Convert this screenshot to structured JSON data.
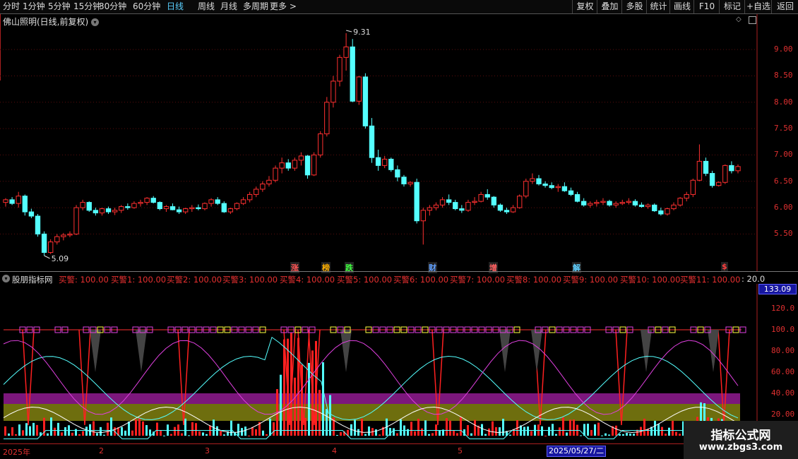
{
  "toolbar": {
    "periods": [
      "分时",
      "1分钟",
      "5分钟",
      "15分钟",
      "30分钟",
      "60分钟",
      "日线",
      "周线",
      "月线",
      "多周期",
      "更多 >"
    ],
    "active_period": "日线",
    "right_buttons": [
      "复权",
      "叠加",
      "多股",
      "统计",
      "画线",
      "F10",
      "标记",
      "+自选",
      "返回"
    ]
  },
  "main_chart": {
    "title": "佛山照明(日线,前复权)",
    "high_label": "9.31",
    "low_label": "5.09",
    "y_ticks": [
      "9.00",
      "8.50",
      "8.00",
      "7.50",
      "7.00",
      "6.50",
      "6.00",
      "5.50"
    ],
    "event_markers": [
      {
        "text": "涨",
        "color": "#ff5555"
      },
      {
        "text": "榜",
        "color": "#ffb000"
      },
      {
        "text": "跌",
        "color": "#40ff40"
      },
      {
        "text": "财",
        "color": "#60a0ff"
      },
      {
        "text": "增",
        "color": "#ff6060"
      },
      {
        "text": "解",
        "color": "#60d0ff"
      },
      {
        "text": "$",
        "color": "#ff4040"
      }
    ]
  },
  "indicator": {
    "name": "股朋指标网",
    "values": [
      "买警: 100.00",
      "买警1: 100.00",
      "买警2: 100.00",
      "买警3: 100.00",
      "买警4: 100.00",
      "买警5: 100.00",
      "买警6: 100.00",
      "买警7: 100.00",
      "买警8: 100.00",
      "买警9: 100.00",
      "买警10: 100.00",
      "买警11: 100.00"
    ],
    "trailing": ": 20.0",
    "current_value": "133.09",
    "y_ticks": [
      "120.0",
      "100.0",
      "80.00",
      "60.00",
      "40.00",
      "20.00"
    ]
  },
  "x_axis": {
    "labels": [
      "2025年",
      "2",
      "3",
      "4",
      "5"
    ],
    "cursor_date": "2025/05/27/二"
  },
  "watermark": {
    "title": "指标公式网",
    "url": "www.zbgs3.com"
  },
  "chart_data": {
    "type": "candlestick",
    "title": "佛山照明(日线,前复权)",
    "ylim": [
      5.1,
      9.4
    ],
    "y_ticks": [
      5.5,
      6.0,
      6.5,
      7.0,
      7.5,
      8.0,
      8.5,
      9.0
    ],
    "x_labels": [
      "2025年",
      "2",
      "3",
      "4",
      "5"
    ],
    "annotations": [
      {
        "text": "9.31",
        "value": 9.31
      },
      {
        "text": "5.09",
        "value": 5.09
      }
    ],
    "ohlc": [
      [
        6.1,
        6.18,
        6.02,
        6.15
      ],
      [
        6.15,
        6.2,
        6.05,
        6.08
      ],
      [
        6.08,
        6.3,
        6.0,
        6.22
      ],
      [
        6.22,
        6.25,
        5.85,
        5.92
      ],
      [
        5.92,
        5.98,
        5.8,
        5.84
      ],
      [
        5.84,
        5.88,
        5.45,
        5.5
      ],
      [
        5.5,
        5.55,
        5.09,
        5.15
      ],
      [
        5.15,
        5.4,
        5.12,
        5.35
      ],
      [
        5.35,
        5.5,
        5.3,
        5.45
      ],
      [
        5.45,
        5.52,
        5.38,
        5.48
      ],
      [
        5.48,
        5.55,
        5.44,
        5.5
      ],
      [
        5.5,
        6.05,
        5.48,
        6.0
      ],
      [
        6.0,
        6.15,
        5.95,
        6.1
      ],
      [
        6.1,
        6.12,
        5.92,
        5.95
      ],
      [
        5.95,
        6.0,
        5.85,
        5.9
      ],
      [
        5.9,
        6.0,
        5.85,
        5.98
      ],
      [
        5.98,
        6.02,
        5.88,
        5.92
      ],
      [
        5.92,
        6.0,
        5.86,
        5.95
      ],
      [
        5.95,
        6.05,
        5.9,
        6.02
      ],
      [
        6.02,
        6.08,
        5.96,
        6.0
      ],
      [
        6.0,
        6.12,
        5.98,
        6.08
      ],
      [
        6.08,
        6.15,
        6.02,
        6.1
      ],
      [
        6.1,
        6.2,
        6.05,
        6.18
      ],
      [
        6.18,
        6.22,
        6.08,
        6.1
      ],
      [
        6.1,
        6.12,
        5.95,
        5.98
      ],
      [
        5.98,
        6.05,
        5.92,
        6.02
      ],
      [
        6.02,
        6.08,
        5.95,
        5.96
      ],
      [
        5.96,
        6.02,
        5.88,
        5.92
      ],
      [
        5.92,
        6.0,
        5.88,
        5.98
      ],
      [
        5.98,
        6.05,
        5.92,
        6.0
      ],
      [
        6.0,
        6.06,
        5.95,
        5.98
      ],
      [
        5.98,
        6.1,
        5.95,
        6.08
      ],
      [
        6.08,
        6.18,
        6.02,
        6.15
      ],
      [
        6.15,
        6.2,
        6.05,
        6.08
      ],
      [
        6.08,
        6.12,
        5.9,
        5.92
      ],
      [
        5.92,
        6.0,
        5.88,
        5.98
      ],
      [
        5.98,
        6.1,
        5.95,
        6.08
      ],
      [
        6.08,
        6.2,
        6.05,
        6.15
      ],
      [
        6.15,
        6.3,
        6.1,
        6.25
      ],
      [
        6.25,
        6.4,
        6.2,
        6.35
      ],
      [
        6.35,
        6.5,
        6.3,
        6.45
      ],
      [
        6.45,
        6.6,
        6.4,
        6.52
      ],
      [
        6.52,
        6.8,
        6.48,
        6.75
      ],
      [
        6.75,
        6.95,
        6.65,
        6.85
      ],
      [
        6.85,
        6.92,
        6.7,
        6.75
      ],
      [
        6.75,
        6.95,
        6.7,
        6.9
      ],
      [
        6.9,
        7.05,
        6.8,
        6.98
      ],
      [
        6.98,
        7.0,
        6.55,
        6.62
      ],
      [
        6.62,
        7.05,
        6.6,
        7.0
      ],
      [
        7.0,
        7.45,
        6.95,
        7.4
      ],
      [
        7.4,
        8.1,
        7.35,
        8.0
      ],
      [
        8.0,
        8.5,
        7.9,
        8.4
      ],
      [
        8.4,
        8.9,
        8.3,
        8.85
      ],
      [
        8.85,
        9.31,
        8.6,
        9.05
      ],
      [
        9.05,
        9.2,
        8.0,
        8.02
      ],
      [
        8.02,
        8.5,
        7.95,
        8.48
      ],
      [
        8.48,
        8.55,
        7.5,
        7.55
      ],
      [
        7.55,
        7.7,
        6.85,
        6.95
      ],
      [
        6.95,
        7.1,
        6.7,
        6.8
      ],
      [
        6.8,
        6.98,
        6.75,
        6.92
      ],
      [
        6.92,
        6.95,
        6.68,
        6.72
      ],
      [
        6.72,
        6.8,
        6.5,
        6.58
      ],
      [
        6.58,
        6.62,
        6.4,
        6.45
      ],
      [
        6.45,
        6.5,
        6.4,
        6.48
      ],
      [
        6.48,
        6.55,
        5.7,
        5.75
      ],
      [
        5.75,
        6.0,
        5.3,
        5.95
      ],
      [
        5.95,
        6.05,
        5.85,
        6.0
      ],
      [
        6.0,
        6.1,
        5.95,
        6.05
      ],
      [
        6.05,
        6.2,
        6.0,
        6.15
      ],
      [
        6.15,
        6.25,
        6.05,
        6.1
      ],
      [
        6.1,
        6.15,
        5.95,
        5.98
      ],
      [
        5.98,
        6.05,
        5.9,
        5.95
      ],
      [
        5.95,
        6.15,
        5.92,
        6.1
      ],
      [
        6.1,
        6.2,
        6.05,
        6.12
      ],
      [
        6.12,
        6.3,
        6.1,
        6.25
      ],
      [
        6.25,
        6.35,
        6.15,
        6.2
      ],
      [
        6.2,
        6.22,
        6.0,
        6.05
      ],
      [
        6.05,
        6.08,
        5.92,
        5.95
      ],
      [
        5.95,
        6.0,
        5.88,
        5.92
      ],
      [
        5.92,
        6.05,
        5.9,
        6.0
      ],
      [
        6.0,
        6.25,
        5.98,
        6.22
      ],
      [
        6.22,
        6.55,
        6.18,
        6.5
      ],
      [
        6.5,
        6.65,
        6.45,
        6.55
      ],
      [
        6.55,
        6.62,
        6.42,
        6.45
      ],
      [
        6.45,
        6.5,
        6.38,
        6.42
      ],
      [
        6.42,
        6.48,
        6.35,
        6.38
      ],
      [
        6.38,
        6.45,
        6.3,
        6.4
      ],
      [
        6.4,
        6.48,
        6.3,
        6.32
      ],
      [
        6.32,
        6.38,
        6.22,
        6.25
      ],
      [
        6.25,
        6.3,
        6.1,
        6.12
      ],
      [
        6.12,
        6.18,
        6.02,
        6.05
      ],
      [
        6.05,
        6.12,
        6.0,
        6.08
      ],
      [
        6.08,
        6.15,
        6.02,
        6.1
      ],
      [
        6.1,
        6.18,
        6.05,
        6.12
      ],
      [
        6.12,
        6.15,
        6.02,
        6.05
      ],
      [
        6.05,
        6.12,
        6.0,
        6.08
      ],
      [
        6.08,
        6.15,
        6.05,
        6.1
      ],
      [
        6.1,
        6.18,
        6.06,
        6.12
      ],
      [
        6.12,
        6.16,
        6.02,
        6.05
      ],
      [
        6.05,
        6.1,
        6.0,
        6.02
      ],
      [
        6.02,
        6.08,
        5.98,
        6.05
      ],
      [
        6.05,
        6.08,
        5.92,
        5.94
      ],
      [
        5.94,
        6.0,
        5.85,
        5.88
      ],
      [
        5.88,
        6.0,
        5.85,
        5.98
      ],
      [
        5.98,
        6.1,
        5.95,
        6.05
      ],
      [
        6.05,
        6.2,
        6.02,
        6.18
      ],
      [
        6.18,
        6.3,
        6.12,
        6.25
      ],
      [
        6.25,
        6.55,
        6.2,
        6.52
      ],
      [
        6.52,
        7.2,
        6.5,
        6.88
      ],
      [
        6.88,
        6.95,
        6.6,
        6.65
      ],
      [
        6.65,
        6.7,
        6.38,
        6.42
      ],
      [
        6.42,
        6.5,
        6.4,
        6.48
      ],
      [
        6.48,
        6.82,
        6.45,
        6.8
      ],
      [
        6.8,
        6.88,
        6.65,
        6.7
      ],
      [
        6.7,
        6.82,
        6.65,
        6.78
      ]
    ]
  }
}
